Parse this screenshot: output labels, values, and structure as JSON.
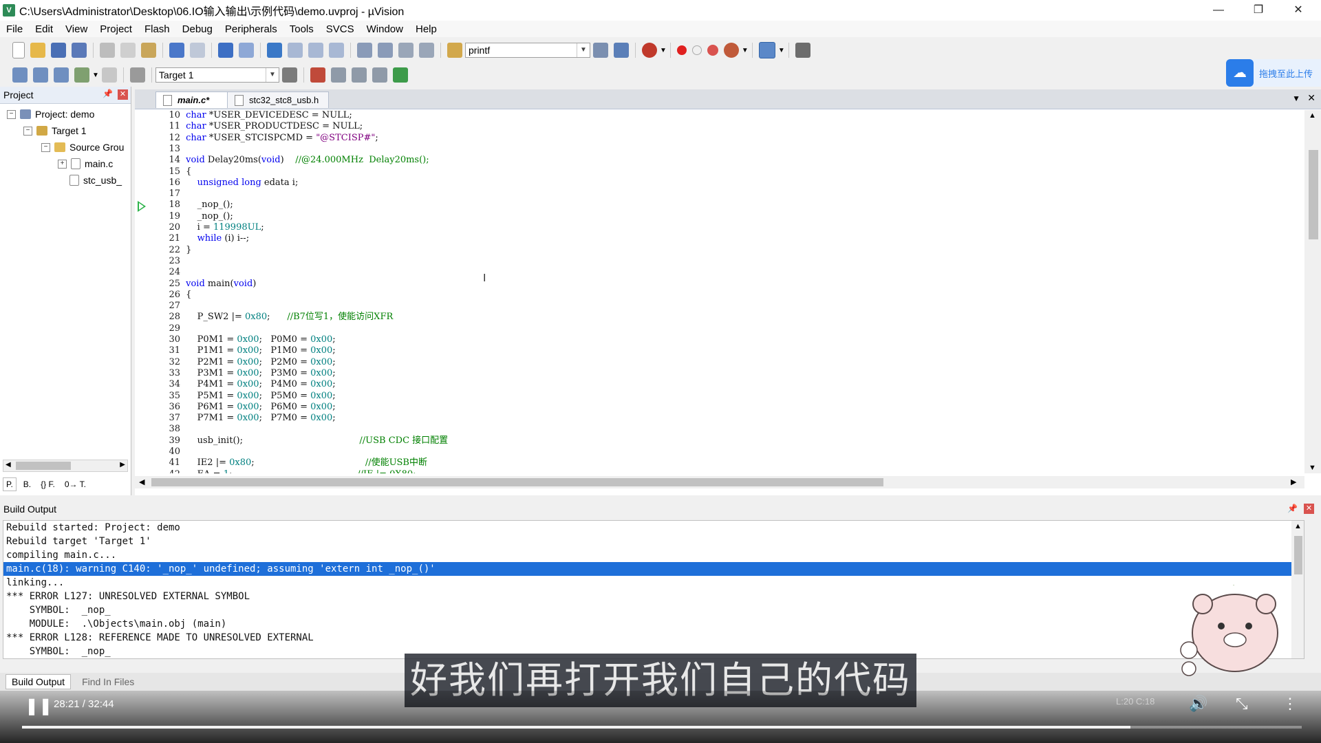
{
  "window": {
    "title": "C:\\Users\\Administrator\\Desktop\\06.IO输入输出\\示例代码\\demo.uvproj - µVision",
    "app_icon": "V",
    "min_glyph": "—",
    "max_glyph": "❐",
    "close_glyph": "✕"
  },
  "menu": [
    "File",
    "Edit",
    "View",
    "Project",
    "Flash",
    "Debug",
    "Peripherals",
    "Tools",
    "SVCS",
    "Window",
    "Help"
  ],
  "toolbar": {
    "find_combo_value": "printf",
    "target_combo_value": "Target 1"
  },
  "upload_widget": {
    "label": "拖拽至此上传"
  },
  "project_panel": {
    "title": "Project",
    "tree": [
      {
        "label": "Project: demo",
        "toggle": "−"
      },
      {
        "label": "Target 1",
        "toggle": "−"
      },
      {
        "label": "Source Grou",
        "toggle": "−"
      },
      {
        "label": "main.c",
        "toggle": "+"
      },
      {
        "label": "stc_usb_",
        "toggle": ""
      }
    ],
    "bottom_tabs": [
      "P.",
      "B.",
      "{} F.",
      "0→ T."
    ]
  },
  "editor": {
    "tabs": [
      {
        "label": "main.c*",
        "active": true
      },
      {
        "label": "stc32_stc8_usb.h",
        "active": false
      }
    ],
    "current_line": 20,
    "arrow_line": 18
  },
  "build": {
    "title": "Build Output",
    "lines": [
      "Rebuild started: Project: demo",
      "Rebuild target 'Target 1'",
      "compiling main.c...",
      "main.c(18): warning C140: '_nop_' undefined; assuming 'extern int _nop_()'",
      "linking...",
      "*** ERROR L127: UNRESOLVED EXTERNAL SYMBOL",
      "    SYMBOL:  _nop_",
      "    MODULE:  .\\Objects\\main.obj (main)",
      "*** ERROR L128: REFERENCE MADE TO UNRESOLVED EXTERNAL",
      "    SYMBOL:  _nop_"
    ],
    "highlight_index": 3,
    "tabs": [
      "Build Output",
      "Find In Files"
    ]
  },
  "video": {
    "subtitle": "好我们再打开我们自己的代码",
    "time": "28:21 / 32:44",
    "progress_fraction": 0.866,
    "status_text": "L:20 C:18"
  },
  "colors": {
    "keyword": "#0000ee",
    "comment": "#008000",
    "string": "#800080",
    "hex": "#008080",
    "highlight": "#1e6fd9"
  }
}
